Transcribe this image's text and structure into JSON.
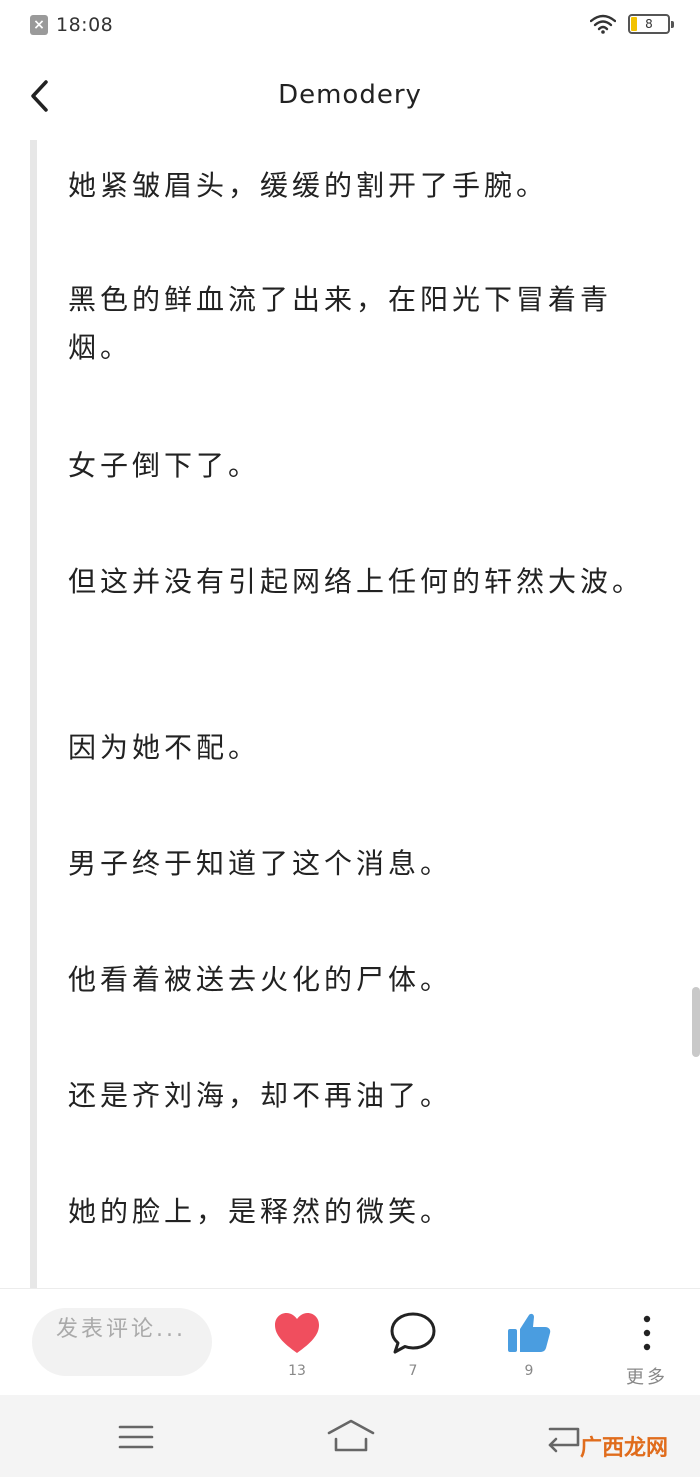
{
  "status_bar": {
    "time": "18:08",
    "battery_level": "8",
    "battery_color": "#f2c200"
  },
  "header": {
    "title": "Demodery",
    "back_icon": "chevron-left-icon"
  },
  "article": {
    "paragraphs": [
      "她紧皱眉头，缓缓的割开了手腕。",
      "黑色的鲜血流了出来，在阳光下冒着青烟。",
      "女子倒下了。",
      "但这并没有引起网络上任何的轩然大波。",
      "因为她不配。",
      "男子终于知道了这个消息。",
      "他看着被送去火化的尸体。",
      "还是齐刘海，却不再油了。",
      "她的脸上，是释然的微笑。"
    ]
  },
  "action_bar": {
    "comment_placeholder": "发表评论...",
    "like_count": "13",
    "comment_count": "7",
    "thumb_count": "9",
    "more_label": "更多",
    "like_color": "#f04e5e",
    "thumb_color": "#4a9de0"
  },
  "watermark": "广西龙网"
}
